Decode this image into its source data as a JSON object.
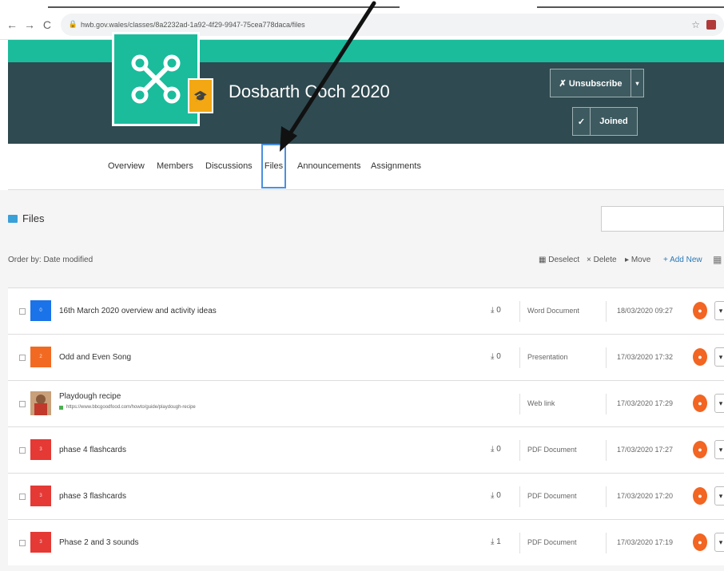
{
  "browser": {
    "url": "hwb.gov.wales/classes/8a2232ad-1a92-4f29-9947-75cea778daca/files"
  },
  "header": {
    "class_name": "Dosbarth Coch 2020",
    "unsubscribe_label": "Unsubscribe",
    "joined_label": "Joined"
  },
  "tabs": [
    {
      "label": "Overview"
    },
    {
      "label": "Members"
    },
    {
      "label": "Discussions"
    },
    {
      "label": "Files"
    },
    {
      "label": "Announcements"
    },
    {
      "label": "Assignments"
    }
  ],
  "files_panel": {
    "title": "Files",
    "order_by": "Order by: Date modified",
    "toolbar": {
      "deselect": "Deselect",
      "delete": "Delete",
      "move": "Move",
      "add_new": "Add New"
    }
  },
  "files": [
    {
      "name": "16th March 2020 overview and activity ideas",
      "link": "",
      "downloads": "0",
      "type": "Word Document",
      "date": "18/03/2020 09:27",
      "color": "#1a73e8"
    },
    {
      "name": "Odd and Even Song",
      "link": "",
      "downloads": "0",
      "type": "Presentation",
      "date": "17/03/2020 17:32",
      "color": "#f26a22"
    },
    {
      "name": "Playdough recipe",
      "link": "https://www.bbcgoodfood.com/howto/guide/playdough-recipe",
      "downloads": "",
      "type": "Web link",
      "date": "17/03/2020 17:29",
      "color": ""
    },
    {
      "name": "phase 4 flashcards",
      "link": "",
      "downloads": "0",
      "type": "PDF Document",
      "date": "17/03/2020 17:27",
      "color": "#e53935"
    },
    {
      "name": "phase 3 flashcards",
      "link": "",
      "downloads": "0",
      "type": "PDF Document",
      "date": "17/03/2020 17:20",
      "color": "#e53935"
    },
    {
      "name": "Phase 2 and 3 sounds",
      "link": "",
      "downloads": "1",
      "type": "PDF Document",
      "date": "17/03/2020 17:19",
      "color": "#e53935"
    }
  ]
}
